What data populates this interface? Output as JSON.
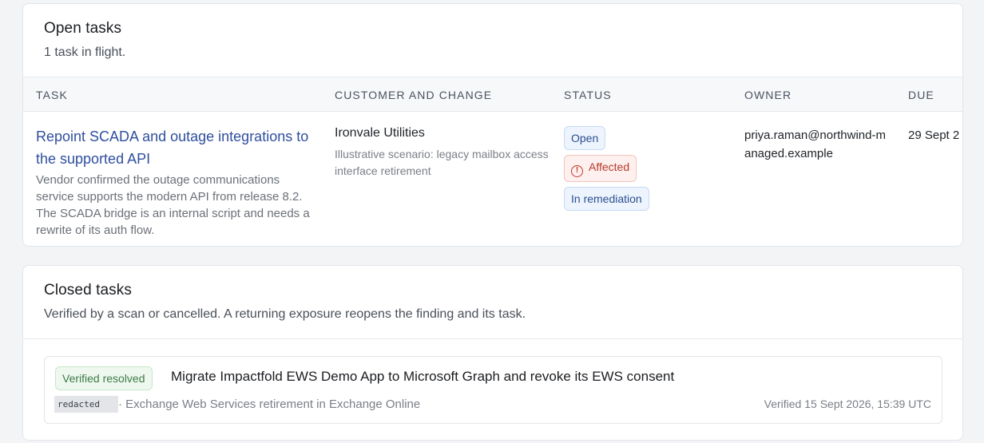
{
  "open_tasks": {
    "title": "Open tasks",
    "subtitle": "1 task in flight.",
    "columns": {
      "task": "TASK",
      "customer": "CUSTOMER AND CHANGE",
      "status": "STATUS",
      "owner": "OWNER",
      "due": "DUE"
    },
    "rows": [
      {
        "title": "Repoint SCADA and outage integrations to the supported API",
        "description": "Vendor confirmed the outage communications service supports the modern API from release 8.2. The SCADA bridge is an internal script and needs a rewrite of its auth flow.",
        "customer": "Ironvale Utilities",
        "scenario": "Illustrative scenario: legacy mailbox access interface retirement",
        "status": {
          "state": "Open",
          "impact": "Affected",
          "progress": "In remediation"
        },
        "owner": "priya.raman@northwind-managed.example",
        "due": "29 Sept 2"
      }
    ]
  },
  "closed_tasks": {
    "title": "Closed tasks",
    "subtitle": "Verified by a scan or cancelled. A returning exposure reopens the finding and its task.",
    "items": [
      {
        "badge": "Verified resolved",
        "title": "Migrate Impactfold EWS Demo App to Microsoft Graph and revoke its EWS consent",
        "redacted_label": "redacted",
        "meta": "· Exchange Web Services retirement in Exchange Online",
        "verified": "Verified 15 Sept 2026, 15:39 UTC"
      }
    ]
  },
  "icons": {
    "affected": "alert-circle-icon"
  },
  "colors": {
    "link": "#2f4f9e",
    "badge_blue": "#2b4f8f",
    "badge_red": "#b63a2a",
    "badge_green": "#3d7a45"
  }
}
